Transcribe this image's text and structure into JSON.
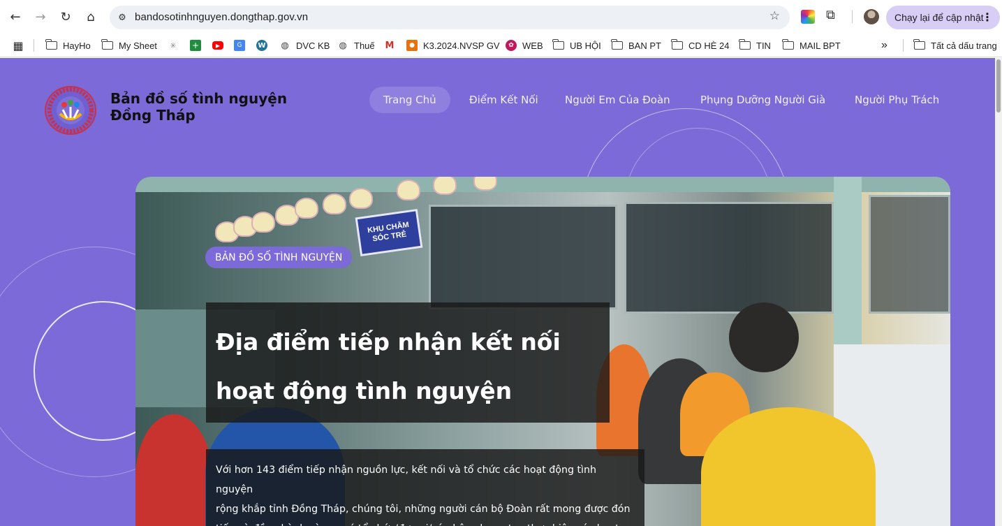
{
  "browser": {
    "url": "bandosotinhnguyen.dongthap.gov.vn",
    "update_button": "Chạy lại để cập nhật",
    "icons": [
      "back-icon",
      "forward-icon",
      "reload-icon",
      "home-icon",
      "site-info-icon",
      "star-icon",
      "extension-icon",
      "puzzle-icon",
      "profile-avatar",
      "menu-dots-icon"
    ]
  },
  "bookmarks": {
    "items": [
      {
        "label": "HayHo",
        "type": "folder"
      },
      {
        "label": "My Sheet",
        "type": "folder"
      },
      {
        "label": "",
        "type": "icon"
      },
      {
        "label": "",
        "type": "sheets"
      },
      {
        "label": "",
        "type": "youtube"
      },
      {
        "label": "",
        "type": "translate"
      },
      {
        "label": "",
        "type": "wordpress"
      },
      {
        "label": "DVC KB",
        "type": "globe"
      },
      {
        "label": "Thuế",
        "type": "globe"
      },
      {
        "label": "",
        "type": "gmail"
      },
      {
        "label": "K3.2024.NVSP GV",
        "type": "site"
      },
      {
        "label": "WEB",
        "type": "site"
      },
      {
        "label": "UB HỘI",
        "type": "folder"
      },
      {
        "label": "BAN PT",
        "type": "folder"
      },
      {
        "label": "CD HÈ 24",
        "type": "folder"
      },
      {
        "label": "TIN",
        "type": "folder"
      },
      {
        "label": "MAIL BPT",
        "type": "folder"
      }
    ],
    "overflow": "»",
    "all_bookmarks": "Tất cả dấu trang"
  },
  "site": {
    "title_line1": "Bản đồ số tình nguyện",
    "title_line2": "Đồng Tháp",
    "nav": [
      {
        "label": "Trang Chủ",
        "active": true
      },
      {
        "label": "Điểm Kết Nối",
        "active": false
      },
      {
        "label": "Người Em Của Đoàn",
        "active": false
      },
      {
        "label": "Phụng Dưỡng Người Già",
        "active": false
      },
      {
        "label": "Người Phụ Trách",
        "active": false
      }
    ],
    "colors": {
      "background": "#7b6ad8",
      "nav_active": "#8f80e0"
    }
  },
  "hero": {
    "badge": "BẢN ĐỒ SỐ TÌNH NGUYỆN",
    "headline_line1": "Địa điểm tiếp nhận kết nối",
    "headline_line2": "hoạt động tình nguyện",
    "description_line1": "Với hơn 143 điểm tiếp nhận nguồn lực, kết nối và tổ chức các hoạt động tình nguyện",
    "description_line2": "rộng khắp tỉnh Đồng Tháp, chúng tôi, những người cán bộ Đoàn rất mong được đón",
    "description_line3": "tiếp và đồng hành cùng quý tổ chức/đơn vị/cá nhân chung tay thực hiện các hoạt",
    "photo_sign": "KHU CHĂM SÓC TRẺ"
  }
}
